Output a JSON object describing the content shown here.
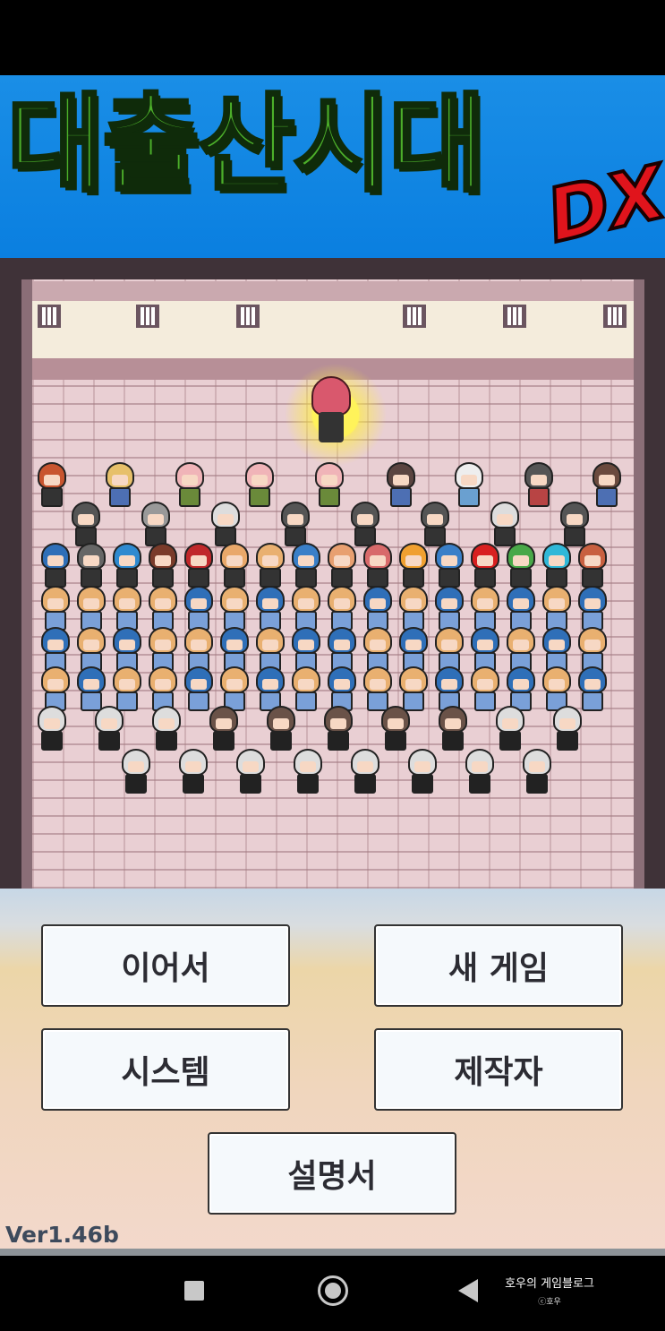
{
  "title": {
    "main": "대출산시대",
    "badge": "DX"
  },
  "menu": {
    "continue_label": "이어서",
    "new_game_label": "새 게임",
    "system_label": "시스템",
    "credits_label": "제작자",
    "manual_label": "설명서",
    "version": "Ver1.46b"
  },
  "watermark": {
    "line1": "호우의 게임블로그",
    "line2": "ⓒ호우"
  },
  "navigation": {
    "icons": [
      "recent-apps-icon",
      "home-icon",
      "back-icon"
    ]
  },
  "colors": {
    "banner": "#0a7fe0",
    "title_fill": "#4caf2a",
    "dx_fill": "#e0141c",
    "button_fill": "#f5f9fc",
    "button_text": "#2c2c33",
    "version_text": "#3d4a5c"
  }
}
